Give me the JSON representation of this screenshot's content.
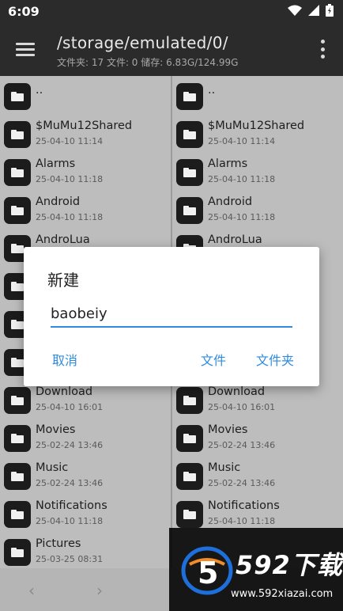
{
  "status_bar": {
    "time": "6:09"
  },
  "toolbar": {
    "path": "/storage/emulated/0/",
    "info": "文件夹: 17  文件: 0  储存: 6.83G/124.99G"
  },
  "left_pane": {
    "items": [
      {
        "name": "..",
        "date": ""
      },
      {
        "name": "$MuMu12Shared",
        "date": "25-04-10 11:14"
      },
      {
        "name": "Alarms",
        "date": "25-04-10 11:18"
      },
      {
        "name": "Android",
        "date": "25-04-10 11:18"
      },
      {
        "name": "AndroLua",
        "date": ""
      },
      {
        "name": "",
        "date": ""
      },
      {
        "name": "",
        "date": ""
      },
      {
        "name": "",
        "date": ""
      },
      {
        "name": "Download",
        "date": "25-04-10 16:01"
      },
      {
        "name": "Movies",
        "date": "25-02-24 13:46"
      },
      {
        "name": "Music",
        "date": "25-02-24 13:46"
      },
      {
        "name": "Notifications",
        "date": "25-04-10 11:18"
      },
      {
        "name": "Pictures",
        "date": "25-03-25 08:31"
      }
    ]
  },
  "right_pane": {
    "items": [
      {
        "name": "..",
        "date": ""
      },
      {
        "name": "$MuMu12Shared",
        "date": "25-04-10 11:14"
      },
      {
        "name": "Alarms",
        "date": "25-04-10 11:18"
      },
      {
        "name": "Android",
        "date": "25-04-10 11:18"
      },
      {
        "name": "AndroLua",
        "date": ""
      },
      {
        "name": "",
        "date": ""
      },
      {
        "name": "",
        "date": ""
      },
      {
        "name": "",
        "date": ""
      },
      {
        "name": "Download",
        "date": "25-04-10 16:01"
      },
      {
        "name": "Movies",
        "date": "25-02-24 13:46"
      },
      {
        "name": "Music",
        "date": "25-02-24 13:46"
      },
      {
        "name": "Notifications",
        "date": "25-04-10 11:18"
      }
    ]
  },
  "dialog": {
    "title": "新建",
    "input_value": "baobeiy",
    "cancel_label": "取消",
    "file_label": "文件",
    "folder_label": "文件夹"
  },
  "bottom_bar": {
    "back_arrow": "‹",
    "forward_arrow": "›"
  },
  "watermark": {
    "title": "592下载",
    "url": "www.592xiazai.com"
  },
  "colors": {
    "accent": "#2e8be0",
    "toolbar_bg": "#2b2b2b"
  }
}
